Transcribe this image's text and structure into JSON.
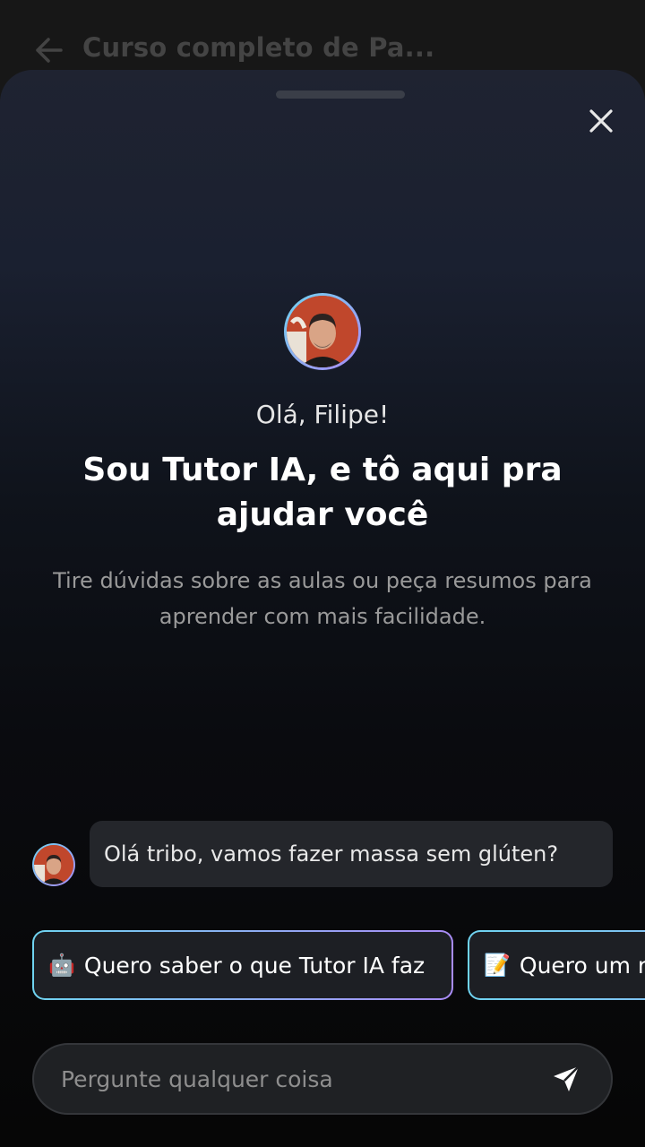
{
  "background_header": {
    "back_icon": "arrow-left-icon",
    "title": "Curso completo de Pa..."
  },
  "sheet": {
    "close_icon": "close-icon",
    "greeting": "Olá, Filipe!",
    "headline": "Sou Tutor IA, e tô aqui pra ajudar você",
    "subtext": "Tire dúvidas sobre as aulas ou peça resumos para aprender com mais facilidade.",
    "message": "Olá tribo, vamos fazer massa sem glúten?",
    "suggestions": [
      {
        "emoji": "🤖",
        "label": "Quero saber o que Tutor IA faz"
      },
      {
        "emoji": "📝",
        "label": "Quero um r"
      }
    ],
    "input": {
      "placeholder": "Pergunte qualquer coisa",
      "value": ""
    },
    "send_icon": "send-icon"
  },
  "colors": {
    "accent_start": "#6fd3f0",
    "accent_end": "#a98bf5",
    "bubble": "#24262b"
  }
}
